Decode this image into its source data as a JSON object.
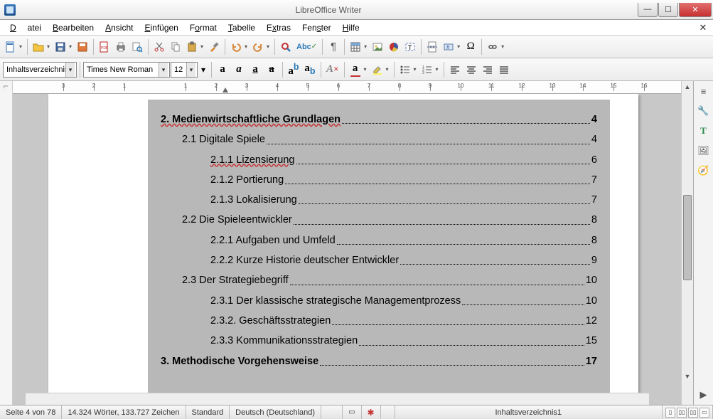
{
  "window": {
    "title": "LibreOffice Writer"
  },
  "menu": {
    "items": [
      "Datei",
      "Bearbeiten",
      "Ansicht",
      "Einfügen",
      "Format",
      "Tabelle",
      "Extras",
      "Fenster",
      "Hilfe"
    ]
  },
  "format_toolbar": {
    "style": "Inhaltsverzeichnis",
    "font": "Times New Roman",
    "size": "12"
  },
  "ruler": {
    "marks": [
      -3,
      -2,
      -1,
      1,
      2,
      3,
      4,
      5,
      6,
      7,
      8,
      9,
      10,
      11,
      12,
      13,
      14,
      15,
      16
    ]
  },
  "toc": [
    {
      "level": 1,
      "text": "2. Medienwirtschaftliche Grundlagen",
      "page": "4",
      "underline": true
    },
    {
      "level": 2,
      "text": "2.1 Digitale Spiele",
      "page": "4"
    },
    {
      "level": 3,
      "text": "2.1.1 Lizensierung",
      "page": "6",
      "underline": true
    },
    {
      "level": 3,
      "text": "2.1.2 Portierung",
      "page": "7"
    },
    {
      "level": 3,
      "text": "2.1.3 Lokalisierung",
      "page": "7"
    },
    {
      "level": 2,
      "text": "2.2 Die Spieleentwickler",
      "page": "8"
    },
    {
      "level": 3,
      "text": "2.2.1 Aufgaben und Umfeld",
      "page": "8"
    },
    {
      "level": 3,
      "text": "2.2.2 Kurze Historie deutscher Entwickler",
      "page": "9"
    },
    {
      "level": 2,
      "text": "2.3 Der Strategiebegriff",
      "page": "10"
    },
    {
      "level": 3,
      "text": "2.3.1 Der klassische strategische Managementprozess",
      "page": "10"
    },
    {
      "level": 3,
      "text": "2.3.2. Geschäftsstrategien",
      "page": "12"
    },
    {
      "level": 3,
      "text": "2.3.3 Kommunikationsstrategien",
      "page": "15"
    },
    {
      "level": 1,
      "text": "3. Methodische Vorgehensweise",
      "page": "17"
    }
  ],
  "status": {
    "page": "Seite 4 von 78",
    "words": "14.324 Wörter, 133.727 Zeichen",
    "style_label": "Standard",
    "lang": "Deutsch (Deutschland)",
    "context": "Inhaltsverzeichnis1"
  }
}
